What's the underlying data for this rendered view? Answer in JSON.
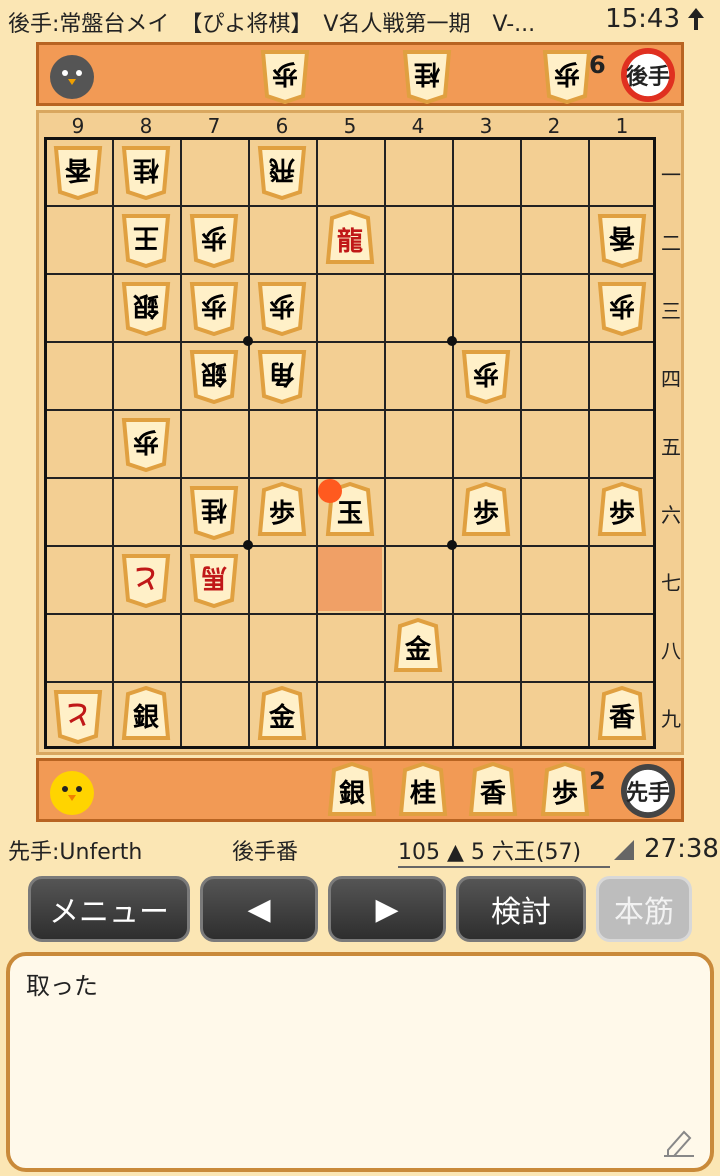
{
  "status_bar": {
    "title": "後手:常盤台メイ　【ぴよ将棋】　V名人戦第一期　V-...",
    "time": "15:43"
  },
  "gote_hand": {
    "pieces": [
      "歩",
      "桂",
      "歩"
    ],
    "pawn_count": "6",
    "badge": "後手"
  },
  "sente_hand": {
    "pieces": [
      "銀",
      "桂",
      "香",
      "歩"
    ],
    "pawn_count": "2",
    "badge": "先手"
  },
  "board": {
    "file_labels": [
      "9",
      "8",
      "7",
      "6",
      "5",
      "4",
      "3",
      "2",
      "1"
    ],
    "rank_labels": [
      "一",
      "二",
      "三",
      "四",
      "五",
      "六",
      "七",
      "八",
      "九"
    ],
    "pieces": [
      {
        "file": 9,
        "rank": 1,
        "kanji": "香",
        "owner": "gote",
        "promoted": false
      },
      {
        "file": 8,
        "rank": 1,
        "kanji": "桂",
        "owner": "gote",
        "promoted": false
      },
      {
        "file": 6,
        "rank": 1,
        "kanji": "飛",
        "owner": "gote",
        "promoted": false
      },
      {
        "file": 8,
        "rank": 2,
        "kanji": "王",
        "owner": "gote",
        "promoted": false
      },
      {
        "file": 7,
        "rank": 2,
        "kanji": "歩",
        "owner": "gote",
        "promoted": false
      },
      {
        "file": 5,
        "rank": 2,
        "kanji": "龍",
        "owner": "sente",
        "promoted": true
      },
      {
        "file": 1,
        "rank": 2,
        "kanji": "香",
        "owner": "gote",
        "promoted": false
      },
      {
        "file": 8,
        "rank": 3,
        "kanji": "銀",
        "owner": "gote",
        "promoted": false
      },
      {
        "file": 7,
        "rank": 3,
        "kanji": "歩",
        "owner": "gote",
        "promoted": false
      },
      {
        "file": 6,
        "rank": 3,
        "kanji": "歩",
        "owner": "gote",
        "promoted": false
      },
      {
        "file": 1,
        "rank": 3,
        "kanji": "歩",
        "owner": "gote",
        "promoted": false
      },
      {
        "file": 7,
        "rank": 4,
        "kanji": "銀",
        "owner": "gote",
        "promoted": false
      },
      {
        "file": 6,
        "rank": 4,
        "kanji": "角",
        "owner": "gote",
        "promoted": false
      },
      {
        "file": 3,
        "rank": 4,
        "kanji": "歩",
        "owner": "gote",
        "promoted": false
      },
      {
        "file": 8,
        "rank": 5,
        "kanji": "歩",
        "owner": "gote",
        "promoted": false
      },
      {
        "file": 7,
        "rank": 6,
        "kanji": "桂",
        "owner": "gote",
        "promoted": false
      },
      {
        "file": 6,
        "rank": 6,
        "kanji": "歩",
        "owner": "sente",
        "promoted": false
      },
      {
        "file": 5,
        "rank": 6,
        "kanji": "玉",
        "owner": "sente",
        "promoted": false
      },
      {
        "file": 3,
        "rank": 6,
        "kanji": "歩",
        "owner": "sente",
        "promoted": false
      },
      {
        "file": 1,
        "rank": 6,
        "kanji": "歩",
        "owner": "sente",
        "promoted": false
      },
      {
        "file": 8,
        "rank": 7,
        "kanji": "と",
        "owner": "gote",
        "promoted": true
      },
      {
        "file": 7,
        "rank": 7,
        "kanji": "馬",
        "owner": "gote",
        "promoted": true
      },
      {
        "file": 4,
        "rank": 8,
        "kanji": "金",
        "owner": "sente",
        "promoted": false
      },
      {
        "file": 9,
        "rank": 9,
        "kanji": "と",
        "owner": "gote",
        "promoted": true
      },
      {
        "file": 8,
        "rank": 9,
        "kanji": "銀",
        "owner": "sente",
        "promoted": false
      },
      {
        "file": 6,
        "rank": 9,
        "kanji": "金",
        "owner": "sente",
        "promoted": false
      },
      {
        "file": 1,
        "rank": 9,
        "kanji": "香",
        "owner": "sente",
        "promoted": false
      }
    ],
    "highlight": {
      "file": 5,
      "rank": 7
    },
    "last_move_marker": {
      "file": 5,
      "rank": 6
    }
  },
  "info_bar": {
    "sente_player": "先手:Unferth",
    "turn": "後手番",
    "move": "105 ▲ 5 六王(57)",
    "elapsed": "27:38"
  },
  "buttons": {
    "menu": "メニュー",
    "prev": "◀",
    "next": "▶",
    "analyze": "検討",
    "mainline": "本筋"
  },
  "comment": {
    "text": "取った"
  },
  "colors": {
    "hand_bg": "#f29a55",
    "board_bg": "#f3cf93",
    "highlight": "#f0a066",
    "marker": "#ff5a1f",
    "promoted_text": "#c01818"
  }
}
